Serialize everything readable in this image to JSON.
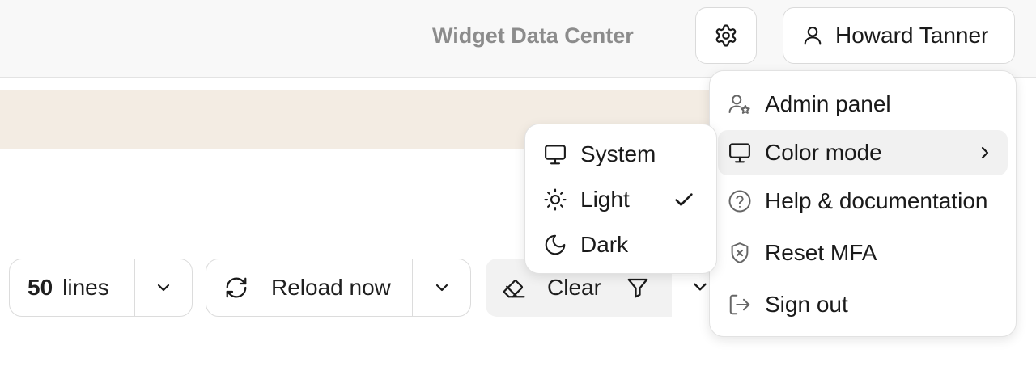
{
  "header": {
    "app_title": "Widget Data Center",
    "user_name": "Howard Tanner"
  },
  "toolbar": {
    "lines_count": "50",
    "lines_label": "lines",
    "reload_label": "Reload now",
    "clear_label": "Clear"
  },
  "user_menu": {
    "items": [
      {
        "label": "Admin panel",
        "icon": "user-star-icon"
      },
      {
        "label": "Color mode",
        "icon": "monitor-icon",
        "has_submenu": true,
        "active": true
      },
      {
        "label": "Help & documentation",
        "icon": "help-circle-icon"
      },
      {
        "label": "Reset MFA",
        "icon": "shield-x-icon"
      },
      {
        "label": "Sign out",
        "icon": "sign-out-icon"
      }
    ]
  },
  "color_mode_menu": {
    "items": [
      {
        "label": "System",
        "icon": "monitor-icon"
      },
      {
        "label": "Light",
        "icon": "sun-icon",
        "selected": true
      },
      {
        "label": "Dark",
        "icon": "moon-icon"
      }
    ]
  },
  "colors": {
    "header_bg": "#f8f8f8",
    "banner_bg": "#f3ece3",
    "title_gray": "#8c8c8c",
    "text": "#1a1a1a",
    "active_item_bg": "#f1f1f1"
  }
}
